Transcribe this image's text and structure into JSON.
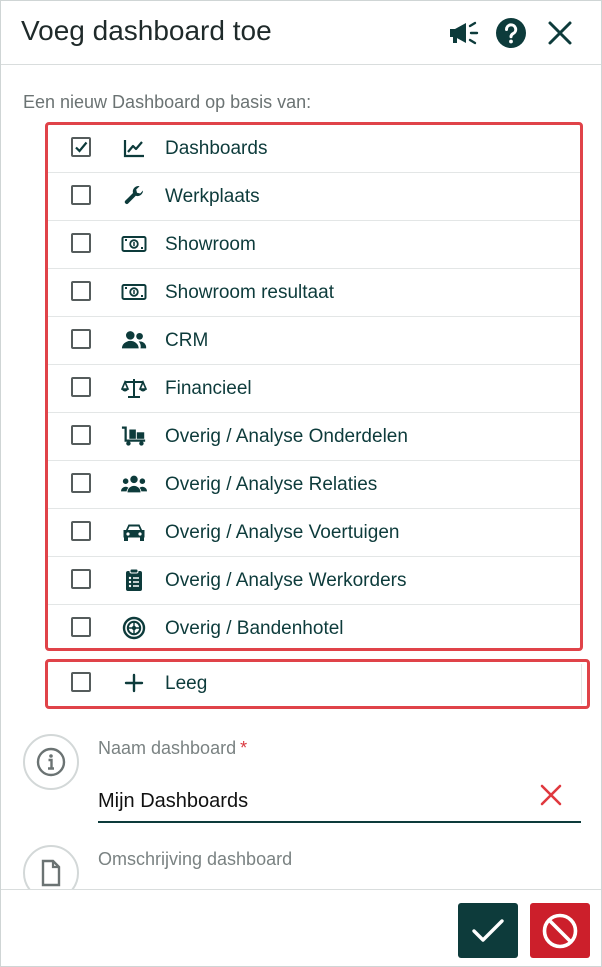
{
  "dialog": {
    "title": "Voeg dashboard toe",
    "header_icons": [
      "megaphone-icon",
      "help-icon",
      "close-icon"
    ]
  },
  "intro": "Een nieuw Dashboard op basis van:",
  "templates": [
    {
      "label": "Dashboards",
      "icon": "line-chart-icon",
      "checked": true
    },
    {
      "label": "Werkplaats",
      "icon": "wrench-icon",
      "checked": false
    },
    {
      "label": "Showroom",
      "icon": "money-bill-icon",
      "checked": false
    },
    {
      "label": "Showroom resultaat",
      "icon": "money-bill-icon",
      "checked": false
    },
    {
      "label": "CRM",
      "icon": "users-icon",
      "checked": false
    },
    {
      "label": "Financieel",
      "icon": "balance-scale-icon",
      "checked": false
    },
    {
      "label": "Overig / Analyse Onderdelen",
      "icon": "dolly-icon",
      "checked": false
    },
    {
      "label": "Overig / Analyse Relaties",
      "icon": "user-group-icon",
      "checked": false
    },
    {
      "label": "Overig / Analyse Voertuigen",
      "icon": "car-icon",
      "checked": false
    },
    {
      "label": "Overig / Analyse Werkorders",
      "icon": "clipboard-list-icon",
      "checked": false
    },
    {
      "label": "Overig / Bandenhotel",
      "icon": "tire-icon",
      "checked": false
    }
  ],
  "empty_option": {
    "label": "Leeg",
    "icon": "plus-icon",
    "checked": false
  },
  "fields": {
    "name": {
      "label": "Naam dashboard",
      "required_mark": "*",
      "value": "Mijn Dashboards",
      "icon": "info-circle-icon",
      "clear_icon": "clear-x-icon"
    },
    "description": {
      "label": "Omschrijving dashboard",
      "icon": "file-icon"
    }
  },
  "footer": {
    "confirm_icon": "checkmark-icon",
    "cancel_icon": "ban-icon"
  },
  "colors": {
    "primary": "#0d3b3b",
    "danger": "#cc1f2b",
    "highlight_border": "#e04349"
  }
}
